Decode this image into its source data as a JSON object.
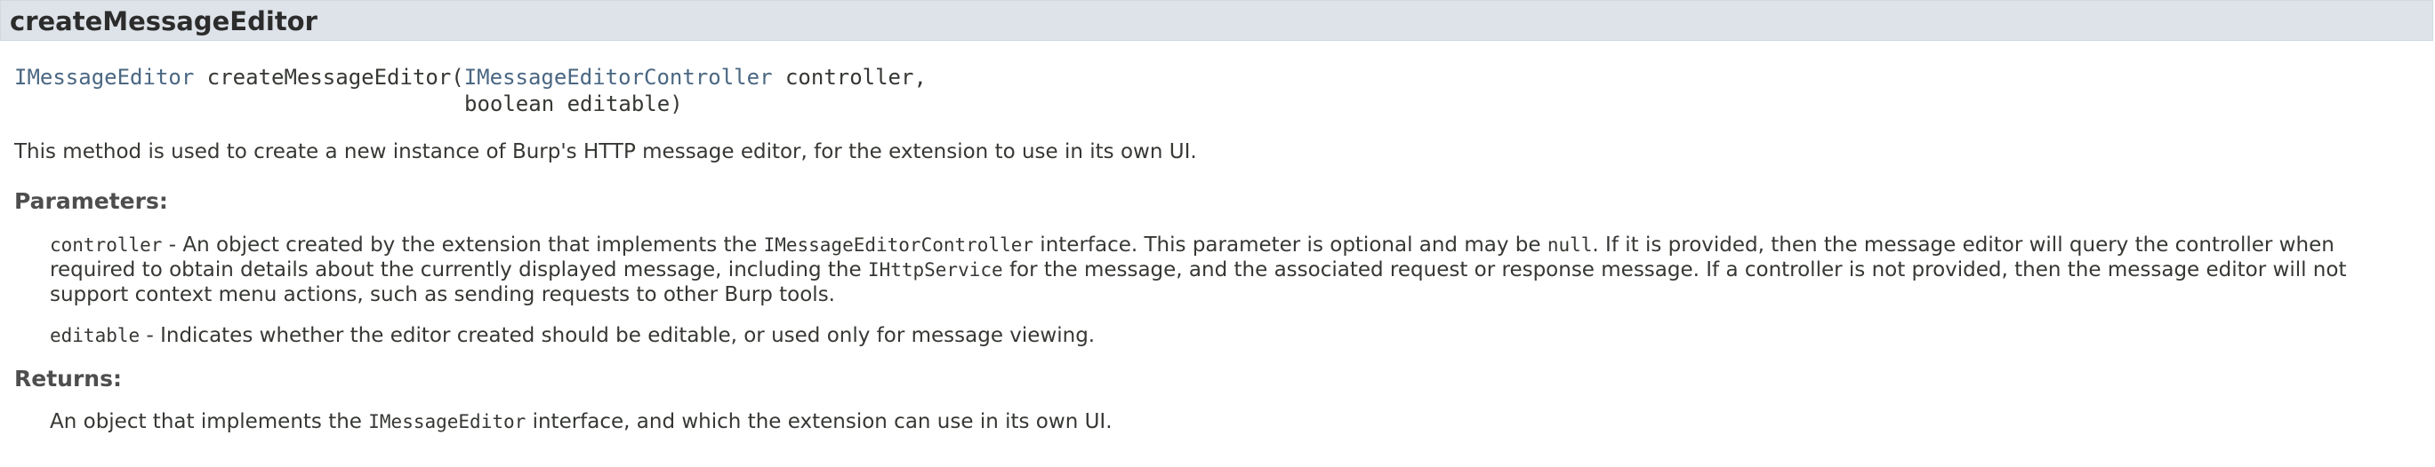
{
  "method": {
    "name": "createMessageEditor",
    "signature": {
      "return_type": "IMessageEditor",
      "method_name": "createMessageEditor(",
      "param1_type": "IMessageEditorController",
      "param1_name": " controller,",
      "line2": "boolean editable)"
    },
    "description": "This method is used to create a new instance of Burp's HTTP message editor, for the extension to use in its own UI."
  },
  "parameters": {
    "label": "Parameters:",
    "items": [
      {
        "name": "controller",
        "text_1": " - An object created by the extension that implements the ",
        "code_1": "IMessageEditorController",
        "text_2": " interface. This parameter is optional and may be ",
        "code_2": "null",
        "text_3": ". If it is provided, then the message editor will query the controller when required to obtain details about the currently displayed message, including the ",
        "code_3": "IHttpService",
        "text_4": " for the message, and the associated request or response message. If a controller is not provided, then the message editor will not support context menu actions, such as sending requests to other Burp tools."
      },
      {
        "name": "editable",
        "text_1": " - Indicates whether the editor created should be editable, or used only for message viewing."
      }
    ]
  },
  "returns": {
    "label": "Returns:",
    "text_1": "An object that implements the ",
    "code_1": "IMessageEditor",
    "text_2": " interface, and which the extension can use in its own UI."
  }
}
